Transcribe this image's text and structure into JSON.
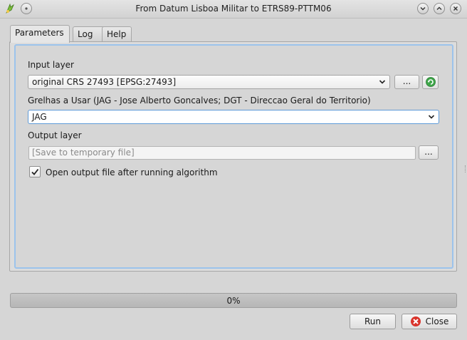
{
  "window": {
    "title": "From Datum Lisboa Militar to ETRS89-PTTM06"
  },
  "tabs": [
    {
      "label": "Parameters",
      "active": true
    },
    {
      "label": "Log",
      "active": false
    },
    {
      "label": "Help",
      "active": false
    }
  ],
  "params": {
    "input_layer_label": "Input layer",
    "input_layer_value": "original CRS 27493 [EPSG:27493]",
    "browse_label": "...",
    "grids_label": "Grelhas a Usar (JAG - Jose Alberto Goncalves; DGT - Direccao Geral do Territorio)",
    "grids_value": "JAG",
    "output_layer_label": "Output layer",
    "output_placeholder": "[Save to temporary file]",
    "output_browse_label": "...",
    "open_output_label": "Open output file after running algorithm",
    "open_output_checked": true
  },
  "progress": {
    "text": "0%",
    "value": 0
  },
  "buttons": {
    "run": "Run",
    "close": "Close"
  },
  "icons": {
    "app": "qgis-logo-icon",
    "sticky": "sticky-pin-icon",
    "minimize": "chevron-down-icon",
    "maximize": "chevron-up-icon",
    "close": "close-x-icon",
    "iterate": "green-refresh-icon",
    "close_button": "red-close-circle-icon"
  },
  "colors": {
    "focus_border": "#9cc3ec",
    "progress_fill": "#6fa6dc",
    "close_icon": "#d9342b",
    "iterate_icon": "#3fa64a"
  }
}
